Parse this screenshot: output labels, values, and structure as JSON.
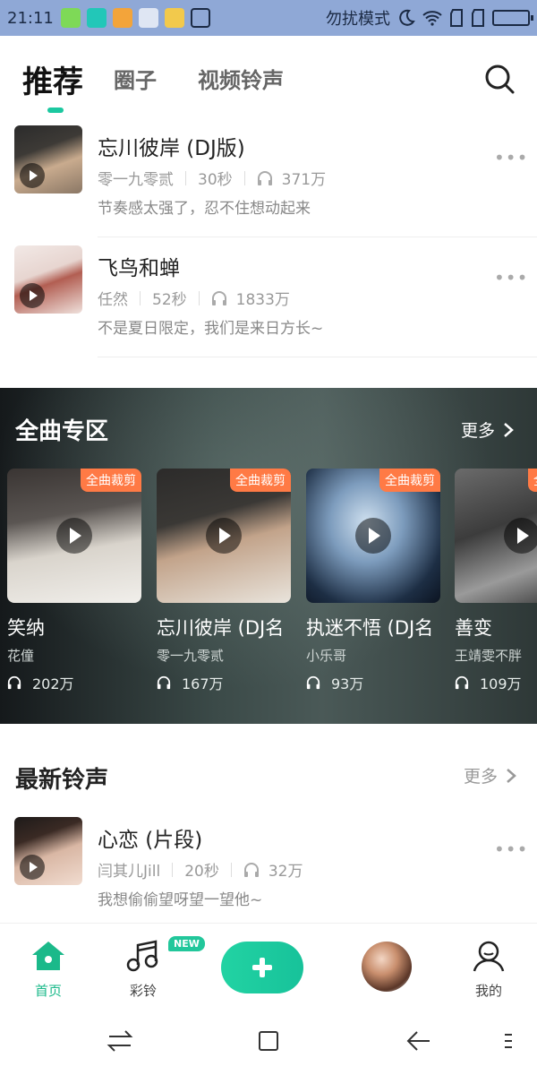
{
  "status_bar": {
    "time": "21:11",
    "dnd_label": "勿扰模式"
  },
  "top_tabs": [
    {
      "label": "推荐",
      "active": true
    },
    {
      "label": "圈子",
      "active": false
    },
    {
      "label": "视频铃声",
      "active": false
    }
  ],
  "songs_recommended": [
    {
      "title": "忘川彼岸 (DJ版)",
      "artist": "零一九零贰",
      "duration": "30秒",
      "plays": "371万",
      "desc": "节奏感太强了，忍不住想动起来"
    },
    {
      "title": "飞鸟和蝉",
      "artist": "任然",
      "duration": "52秒",
      "plays": "1833万",
      "desc": "不是夏日限定，我们是来日方长~"
    }
  ],
  "full_zone": {
    "title": "全曲专区",
    "more": "更多",
    "badge": "全曲裁剪",
    "cards": [
      {
        "title": "笑纳",
        "artist": "花僮",
        "plays": "202万"
      },
      {
        "title": "忘川彼岸 (DJ名",
        "artist": "零一九零贰",
        "plays": "167万"
      },
      {
        "title": "执迷不悟 (DJ名",
        "artist": "小乐哥",
        "plays": "93万"
      },
      {
        "title": "善变",
        "artist": "王靖雯不胖",
        "plays": "109万"
      }
    ]
  },
  "latest": {
    "title": "最新铃声",
    "more": "更多",
    "songs": [
      {
        "title": "心恋 (片段)",
        "artist": "闫其儿Jill",
        "duration": "20秒",
        "plays": "32万",
        "desc": "我想偷偷望呀望一望他~"
      }
    ]
  },
  "bottom_nav": {
    "home": "首页",
    "ringtone": "彩铃",
    "new_badge": "NEW",
    "mine": "我的"
  },
  "colors": {
    "accent": "#1cc8a0",
    "badge": "#ff7a45"
  }
}
